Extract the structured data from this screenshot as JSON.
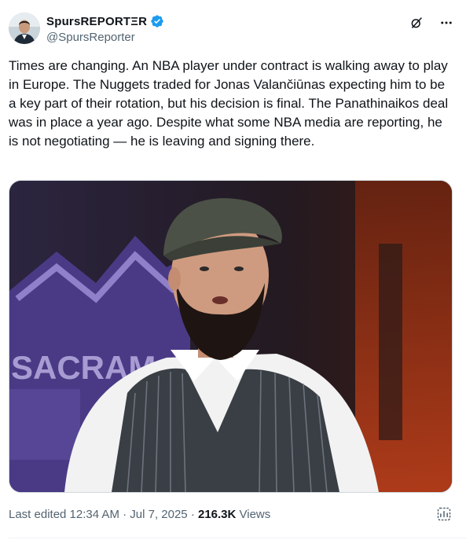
{
  "author": {
    "display_name": "SpursREPORTΞR",
    "handle": "@SpursReporter",
    "verified": true
  },
  "tweet": {
    "text": "Times are changing. An NBA player under contract is walking away to play in Europe. The Nuggets traded for Jonas Valančiūnas expecting him to be a key part of their rotation, but his decision is final. The Panathinaikos deal was in place a year ago. Despite what some NBA media are reporting, he is not negotiating — he is leaving and signing there."
  },
  "media": {
    "backdrop_text": "SACRAM"
  },
  "meta": {
    "edited_time": "Last edited 12:34 AM · Jul 7, 2025 · ",
    "views_count": "216.3K",
    "views_label": " Views"
  },
  "icons": {
    "more": "more-icon",
    "grok": "grok-icon",
    "analytics": "analytics-icon"
  },
  "colors": {
    "verified_blue": "#1d9bf0",
    "secondary_text": "#536471",
    "purple_backdrop": "#4a3a86"
  }
}
